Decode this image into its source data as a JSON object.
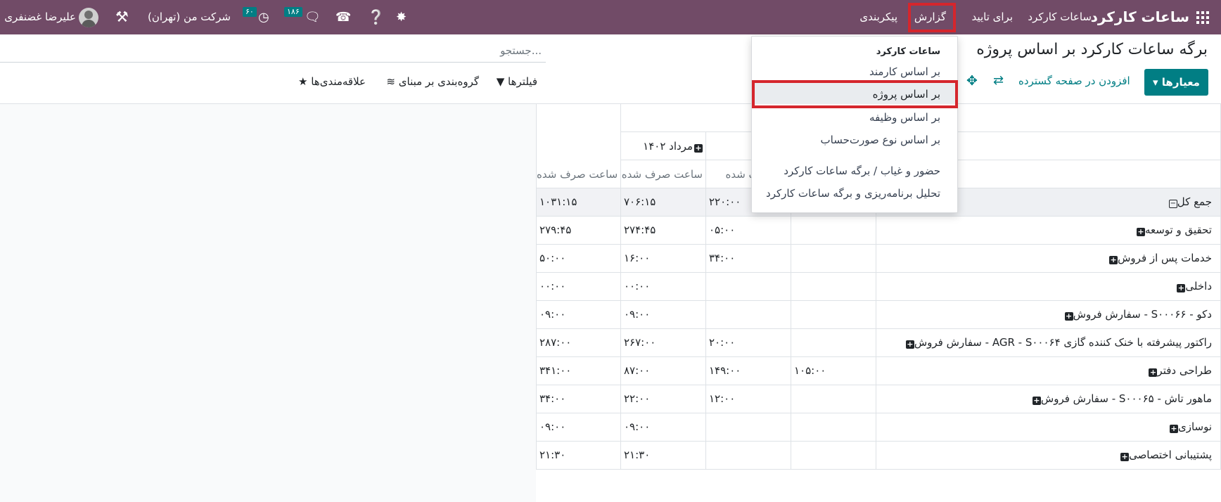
{
  "navbar": {
    "app_title": "ساعات کارکرد",
    "menus": [
      "ساعات کارکرد",
      "برای تایید",
      "گزارش",
      "پیکربندی"
    ],
    "company": "شرکت من (تهران)",
    "user_name": "علیرضا غضنفری",
    "activities_badge": "۶۰",
    "messages_badge": "۱۸۶",
    "colors": {
      "bar": "#714b67",
      "badge": "#017e84",
      "highlight": "#d5262d"
    }
  },
  "control_panel": {
    "title": "برگه ساعات کارکرد بر اساس پروژه",
    "measures_label": "معیارها",
    "insert_label": "افزودن در صفحه گسترده",
    "search_placeholder": "جستجو...",
    "filters_label": "فیلترها",
    "groupby_label": "گروه‌بندی بر مبنای",
    "favorites_label": "علاقه‌مندی‌ها"
  },
  "dropdown": {
    "section_title": "ساعات کارکرد",
    "items": [
      "بر اساس کارمند",
      "بر اساس پروژه",
      "بر اساس وظیفه",
      "بر اساس نوع صورت‌حساب",
      "حضور و غیاب / برگه ساعات کارکرد",
      "تحلیل برنامه‌ریزی و برگه ساعات کارکرد"
    ],
    "active_item": "بر اساس پروژه"
  },
  "pivot": {
    "col_group_label": "مرداد ۱۴۰۲",
    "col_group_partial": "ت",
    "measure_label": "ساعت صرف شده",
    "measure_label_partial": "ت صرف شده",
    "total_label": "جمع کل",
    "rows": [
      {
        "label": "جمع کل",
        "c1": "",
        "c2": "۲۲۰:۰۰",
        "c3": "۷۰۶:۱۵",
        "c4": "۱۰۳۱:۱۵"
      },
      {
        "label": "تحقیق و توسعه",
        "c1": "",
        "c2": "۰۵:۰۰",
        "c3": "۲۷۴:۴۵",
        "c4": "۲۷۹:۴۵"
      },
      {
        "label": "خدمات پس از فروش",
        "c1": "",
        "c2": "۳۴:۰۰",
        "c3": "۱۶:۰۰",
        "c4": "۵۰:۰۰"
      },
      {
        "label": "داخلی",
        "c1": "",
        "c2": "",
        "c3": "۰۰:۰۰",
        "c4": "۰۰:۰۰"
      },
      {
        "label": "دکو - S۰۰۰۶۶ - سفارش فروش",
        "c1": "",
        "c2": "",
        "c3": "۰۹:۰۰",
        "c4": "۰۹:۰۰"
      },
      {
        "label": "راکتور پیشرفته با خنک کننده گازی AGR - S۰۰۰۶۴ - سفارش فروش",
        "c1": "",
        "c2": "۲۰:۰۰",
        "c3": "۲۶۷:۰۰",
        "c4": "۲۸۷:۰۰"
      },
      {
        "label": "طراحی دفتر",
        "c1": "۱۰۵:۰۰",
        "c2": "۱۴۹:۰۰",
        "c3": "۸۷:۰۰",
        "c4": "۳۴۱:۰۰"
      },
      {
        "label": "ماهور تاش - S۰۰۰۶۵ - سفارش فروش",
        "c1": "",
        "c2": "۱۲:۰۰",
        "c3": "۲۲:۰۰",
        "c4": "۳۴:۰۰"
      },
      {
        "label": "نوسازی",
        "c1": "",
        "c2": "",
        "c3": "۰۹:۰۰",
        "c4": "۰۹:۰۰"
      },
      {
        "label": "پشتیبانی اختصاصی",
        "c1": "",
        "c2": "",
        "c3": "۲۱:۳۰",
        "c4": "۲۱:۳۰"
      }
    ]
  }
}
